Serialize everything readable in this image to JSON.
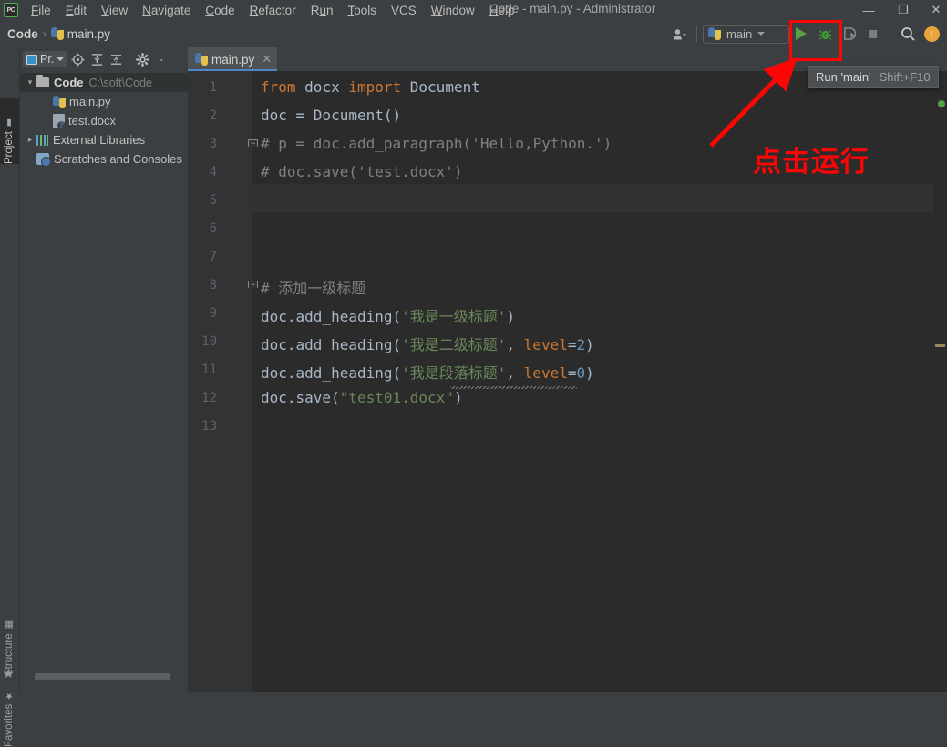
{
  "app": {
    "logo_text": "PC",
    "window_title": "Code - main.py - Administrator"
  },
  "menubar": {
    "items": [
      {
        "name": "file",
        "pre": "",
        "mn": "F",
        "post": "ile"
      },
      {
        "name": "edit",
        "pre": "",
        "mn": "E",
        "post": "dit"
      },
      {
        "name": "view",
        "pre": "",
        "mn": "V",
        "post": "iew"
      },
      {
        "name": "navigate",
        "pre": "",
        "mn": "N",
        "post": "avigate"
      },
      {
        "name": "code",
        "pre": "",
        "mn": "C",
        "post": "ode"
      },
      {
        "name": "refactor",
        "pre": "",
        "mn": "R",
        "post": "efactor"
      },
      {
        "name": "run",
        "pre": "R",
        "mn": "u",
        "post": "n"
      },
      {
        "name": "tools",
        "pre": "",
        "mn": "T",
        "post": "ools"
      },
      {
        "name": "vcs",
        "pre": "VCS",
        "mn": "",
        "post": ""
      },
      {
        "name": "window",
        "pre": "",
        "mn": "W",
        "post": "indow"
      },
      {
        "name": "help",
        "pre": "",
        "mn": "H",
        "post": "elp"
      }
    ]
  },
  "window_controls": {
    "minimize": "—",
    "maximize": "❐",
    "close": "✕"
  },
  "breadcrumb": {
    "project": "Code",
    "separator": "›",
    "file": "main.py"
  },
  "toolbar": {
    "user_icon": "👤",
    "run_config_name": "main",
    "run_button": "run-icon",
    "debug_button": "debug-icon",
    "coverage_button": "coverage-icon",
    "stop_button": "stop-icon",
    "search_button": "🔍",
    "update_button": "↑"
  },
  "tool_stripe": {
    "project": "Project",
    "structure": "Structure",
    "favorites": "Favorites"
  },
  "project_panel": {
    "title": "Pr.",
    "toolbar_icons": [
      "locate-icon",
      "expand-all-icon",
      "collapse-all-icon",
      "settings-gear-icon",
      "more-icon"
    ],
    "tree": [
      {
        "name": "root-code",
        "arrow": "⌄",
        "icon": "folder",
        "label": "Code",
        "path": "C:\\soft\\Code",
        "selected": true,
        "indent": 0
      },
      {
        "name": "file-main-py",
        "arrow": "",
        "icon": "python",
        "label": "main.py",
        "path": "",
        "selected": false,
        "indent": 1
      },
      {
        "name": "file-test-docx",
        "arrow": "",
        "icon": "docx",
        "label": "test.docx",
        "path": "",
        "selected": false,
        "indent": 1
      },
      {
        "name": "external-libraries",
        "arrow": "›",
        "icon": "lib",
        "label": "External Libraries",
        "path": "",
        "selected": false,
        "indent": 0
      },
      {
        "name": "scratches-and-consoles",
        "arrow": "",
        "icon": "scratch",
        "label": "Scratches and Consoles",
        "path": "",
        "selected": false,
        "indent": 0
      }
    ]
  },
  "editor": {
    "tab_label": "main.py",
    "tab_close": "✕",
    "caret_line": 6,
    "lines": [
      {
        "num": 1,
        "fold": "",
        "tokens": [
          {
            "t": "from ",
            "c": "kw"
          },
          {
            "t": "docx ",
            "c": "id"
          },
          {
            "t": "import ",
            "c": "kw"
          },
          {
            "t": "Document",
            "c": "id"
          }
        ]
      },
      {
        "num": 2,
        "fold": "",
        "tokens": [
          {
            "t": "doc = Document()",
            "c": "id"
          }
        ]
      },
      {
        "num": 3,
        "fold": "top",
        "tokens": [
          {
            "t": "# p = doc.add_paragraph('Hello,Python.')",
            "c": "cm"
          }
        ]
      },
      {
        "num": 4,
        "fold": "",
        "tokens": [
          {
            "t": "# doc.save('test.docx')",
            "c": "cm"
          }
        ]
      },
      {
        "num": 5,
        "fold": "",
        "tokens": []
      },
      {
        "num": 6,
        "fold": "",
        "tokens": []
      },
      {
        "num": 7,
        "fold": "",
        "tokens": []
      },
      {
        "num": 8,
        "fold": "top",
        "tokens": [
          {
            "t": "# 添加一级标题",
            "c": "cm"
          }
        ]
      },
      {
        "num": 9,
        "fold": "",
        "tokens": [
          {
            "t": "doc.add_heading(",
            "c": "id"
          },
          {
            "t": "'我是一级标题'",
            "c": "str"
          },
          {
            "t": ")",
            "c": "id"
          }
        ]
      },
      {
        "num": 10,
        "fold": "",
        "tokens": [
          {
            "t": "doc.add_heading(",
            "c": "id"
          },
          {
            "t": "'我是二级标题'",
            "c": "str"
          },
          {
            "t": ", ",
            "c": "id"
          },
          {
            "t": "level",
            "c": "kw"
          },
          {
            "t": "=",
            "c": "id"
          },
          {
            "t": "2",
            "c": "num"
          },
          {
            "t": ")",
            "c": "id"
          }
        ]
      },
      {
        "num": 11,
        "fold": "",
        "tokens": [
          {
            "t": "doc.add_heading(",
            "c": "id"
          },
          {
            "t": "'我是段落标题'",
            "c": "str"
          },
          {
            "t": ", ",
            "c": "id"
          },
          {
            "t": "level",
            "c": "kw"
          },
          {
            "t": "=",
            "c": "id"
          },
          {
            "t": "0",
            "c": "num"
          },
          {
            "t": ")",
            "c": "id"
          }
        ]
      },
      {
        "num": 12,
        "fold": "",
        "tokens": [
          {
            "t": "doc.save(",
            "c": "id"
          },
          {
            "t": "\"test01.docx\"",
            "c": "str"
          },
          {
            "t": ")",
            "c": "id"
          }
        ]
      },
      {
        "num": 13,
        "fold": "",
        "tokens": []
      }
    ]
  },
  "tooltip": {
    "label": "Run 'main'",
    "shortcut": "Shift+F10"
  },
  "annotations": {
    "red_text": "点击运行",
    "red_color": "#fb0505",
    "rect_target": "run-button"
  },
  "colors": {
    "editor_bg": "#2b2b2b",
    "panel_bg": "#3c3f41",
    "keyword": "#cc7832",
    "string": "#6a8759",
    "number": "#6897bb",
    "comment": "#808080",
    "identifier": "#a9b7c6",
    "tab_accent": "#4a88c7",
    "run_green": "#5a9e47"
  }
}
